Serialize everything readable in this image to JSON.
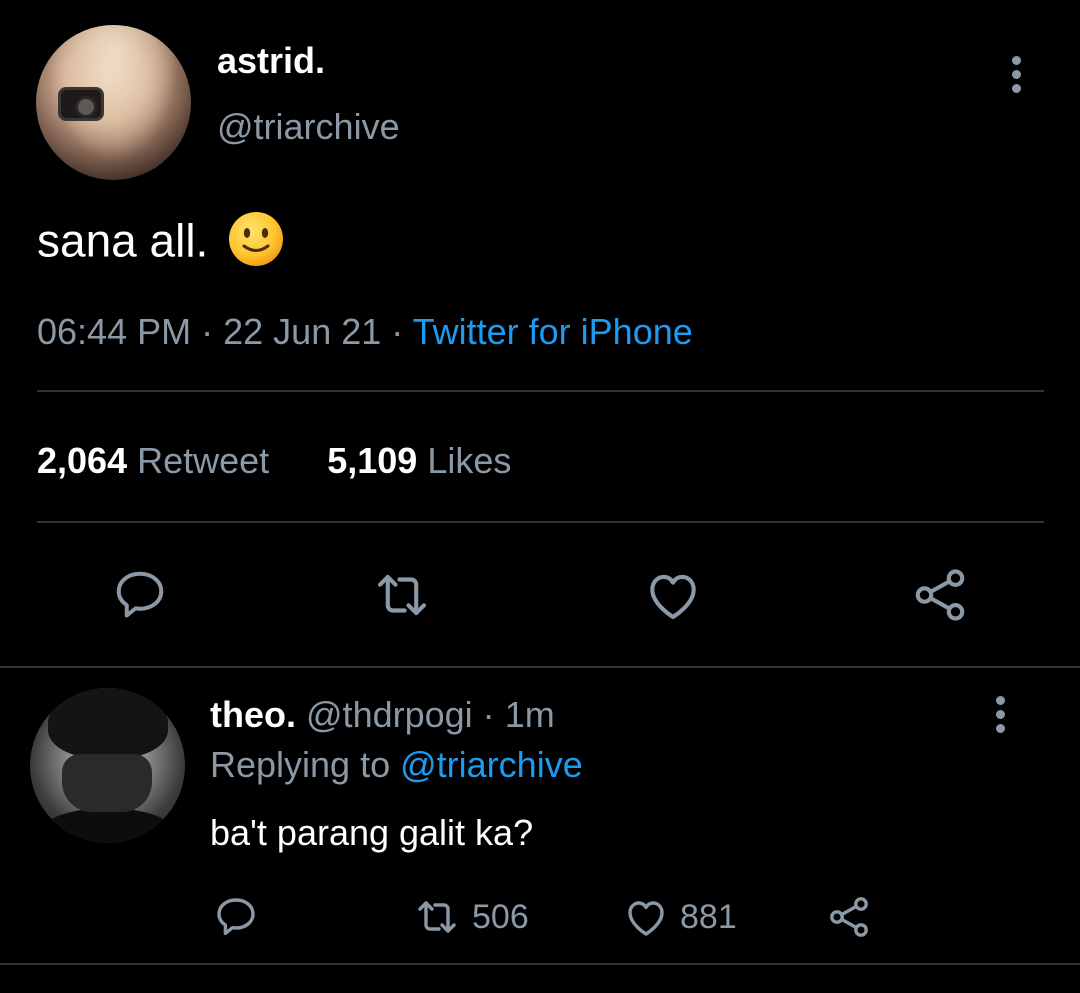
{
  "tweet": {
    "author": {
      "display_name": "astrid.",
      "handle": "@triarchive"
    },
    "text": "sana all.",
    "emoji": "slightly-smiling-face-emoji",
    "time": "06:44 PM",
    "date": "22 Jun 21",
    "separator": "·",
    "source": "Twitter for iPhone",
    "stats": {
      "retweets": "2,064",
      "retweets_label": "Retweet",
      "likes": "5,109",
      "likes_label": "Likes"
    },
    "actions": [
      "reply-icon",
      "retweet-icon",
      "like-icon",
      "share-icon"
    ]
  },
  "reply": {
    "author": {
      "display_name": "theo.",
      "handle": "@thdrpogi"
    },
    "age": "1m",
    "separator": "·",
    "replying_prefix": "Replying to",
    "replying_to": "@triarchive",
    "text": "ba't parang galit ka?",
    "retweets": "506",
    "likes": "881",
    "actions": [
      "reply-icon",
      "retweet-icon",
      "like-icon",
      "share-icon"
    ]
  },
  "colors": {
    "background": "#000000",
    "muted": "#8b98a5",
    "link": "#1d9bf0",
    "divider": "#2f3336",
    "text": "#ffffff"
  }
}
